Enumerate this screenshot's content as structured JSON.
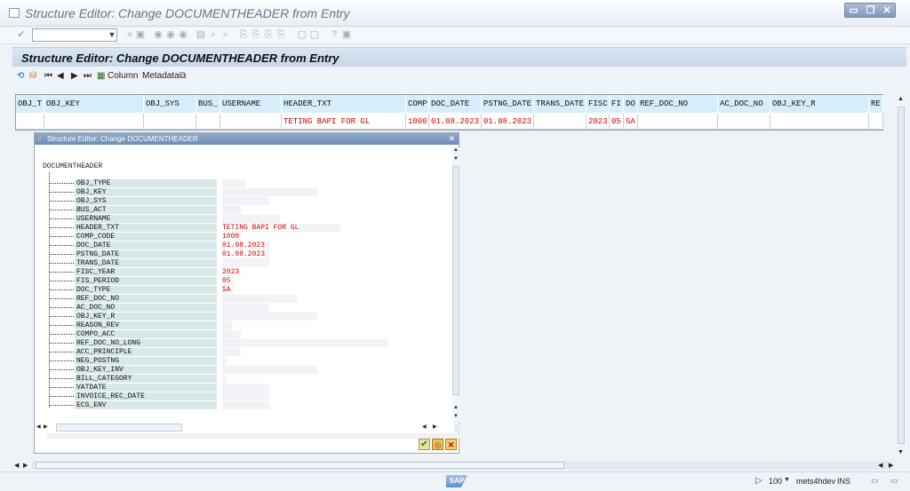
{
  "window": {
    "title": "Structure Editor: Change DOCUMENTHEADER from Entry"
  },
  "page": {
    "title": "Structure Editor: Change DOCUMENTHEADER from Entry"
  },
  "toolbar": {
    "column_label": "Column",
    "metadata_label": "Metadata"
  },
  "table": {
    "columns": [
      "OBJ_T",
      "OBJ_KEY",
      "OBJ_SYS",
      "BUS_",
      "USERNAME",
      "HEADER_TXT",
      "COMP",
      "DOC_DATE",
      "PSTNG_DATE",
      "TRANS_DATE",
      "FISC",
      "FI",
      "DO",
      "REF_DOC_NO",
      "AC_DOC_NO",
      "OBJ_KEY_R",
      "RE"
    ],
    "row": [
      "",
      "",
      "",
      "",
      "",
      "TETING BAPI FOR GL",
      "1000",
      "01.08.2023",
      "01.08.2023",
      "",
      "2023",
      "05",
      "SA",
      "",
      "",
      "",
      ""
    ]
  },
  "dialog": {
    "title": "Structure Editor: Change DOCUMENTHEADER",
    "root": "DOCUMENTHEADER",
    "fields": [
      {
        "name": "OBJ_TYPE",
        "value": ""
      },
      {
        "name": "OBJ_KEY",
        "value": ""
      },
      {
        "name": "OBJ_SYS",
        "value": ""
      },
      {
        "name": "BUS_ACT",
        "value": ""
      },
      {
        "name": "USERNAME",
        "value": ""
      },
      {
        "name": "HEADER_TXT",
        "value": "TETING BAPI FOR GL"
      },
      {
        "name": "COMP_CODE",
        "value": "1000"
      },
      {
        "name": "DOC_DATE",
        "value": "01.08.2023"
      },
      {
        "name": "PSTNG_DATE",
        "value": "01.08.2023"
      },
      {
        "name": "TRANS_DATE",
        "value": ""
      },
      {
        "name": "FISC_YEAR",
        "value": "2023"
      },
      {
        "name": "FIS_PERIOD",
        "value": "05"
      },
      {
        "name": "DOC_TYPE",
        "value": "SA"
      },
      {
        "name": "REF_DOC_NO",
        "value": ""
      },
      {
        "name": "AC_DOC_NO",
        "value": ""
      },
      {
        "name": "OBJ_KEY_R",
        "value": ""
      },
      {
        "name": "REASON_REV",
        "value": ""
      },
      {
        "name": "COMPO_ACC",
        "value": ""
      },
      {
        "name": "REF_DOC_NO_LONG",
        "value": ""
      },
      {
        "name": "ACC_PRINCIPLE",
        "value": ""
      },
      {
        "name": "NEG_POSTNG",
        "value": ""
      },
      {
        "name": "OBJ_KEY_INV",
        "value": ""
      },
      {
        "name": "BILL_CATEGORY",
        "value": ""
      },
      {
        "name": "VATDATE",
        "value": ""
      },
      {
        "name": "INVOICE_REC_DATE",
        "value": ""
      },
      {
        "name": "ECS_ENV",
        "value": ""
      }
    ]
  },
  "status": {
    "zoom": "100",
    "system": "mets4hdev",
    "mode": "INS",
    "sap_logo": "SAP"
  }
}
